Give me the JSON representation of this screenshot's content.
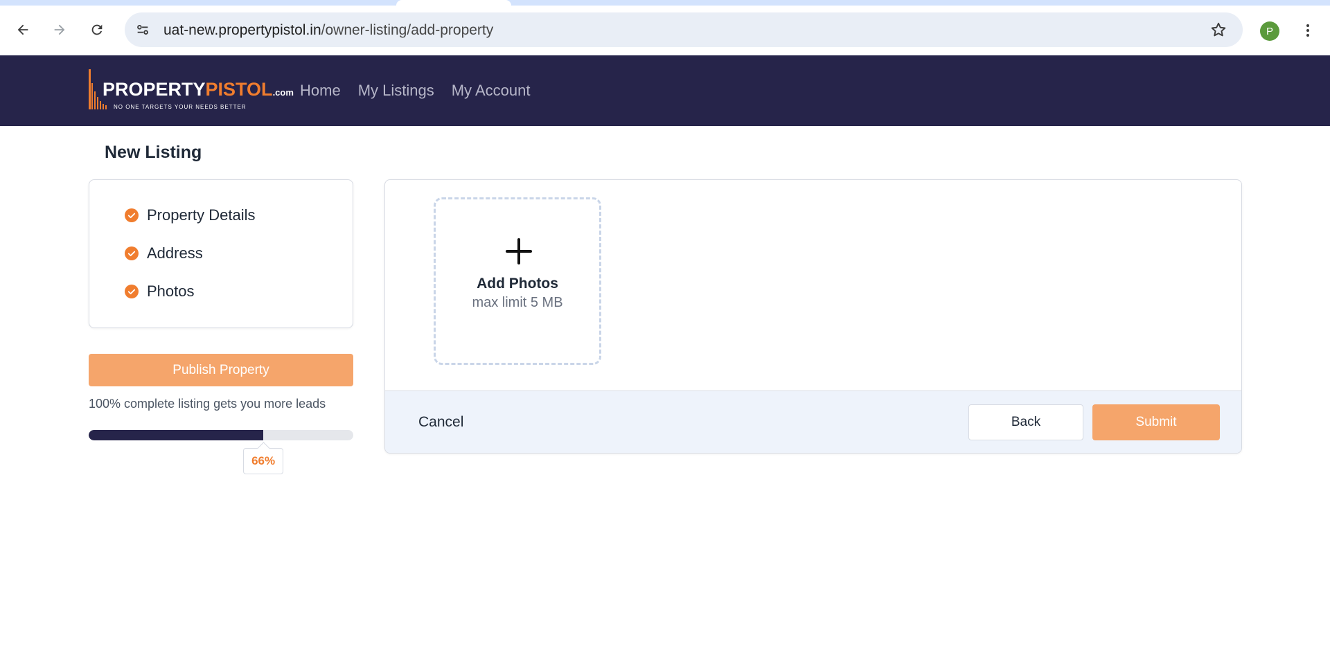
{
  "browser": {
    "url_host": "uat-new.propertypistol.in",
    "url_path": "/owner-listing/add-property",
    "profile_initial": "P",
    "icons": [
      "back-arrow-icon",
      "forward-arrow-icon",
      "reload-icon",
      "site-settings-icon",
      "bookmark-star-icon",
      "kebab-menu-icon"
    ]
  },
  "header": {
    "logo": {
      "brand_part1": "PROPERTY",
      "brand_part2": "PISTOL",
      "brand_suffix": ".com",
      "tagline": "NO ONE TARGETS YOUR NEEDS BETTER"
    },
    "nav": [
      {
        "label": "Home"
      },
      {
        "label": "My Listings"
      },
      {
        "label": "My Account"
      }
    ]
  },
  "page": {
    "title": "New Listing"
  },
  "steps": [
    {
      "label": "Property Details",
      "status": "complete"
    },
    {
      "label": "Address",
      "status": "complete"
    },
    {
      "label": "Photos",
      "status": "complete"
    }
  ],
  "sidebar": {
    "publish_label": "Publish Property",
    "hint": "100% complete listing gets you more leads",
    "progress_percent": 66,
    "progress_label": "66%"
  },
  "upload": {
    "title": "Add Photos",
    "subtitle": "max limit 5 MB"
  },
  "footer": {
    "cancel_label": "Cancel",
    "back_label": "Back",
    "submit_label": "Submit"
  },
  "colors": {
    "header_bg": "#26244a",
    "accent": "#f07d2e",
    "button_accent": "#f5a56b",
    "progress_fill": "#26244a"
  }
}
